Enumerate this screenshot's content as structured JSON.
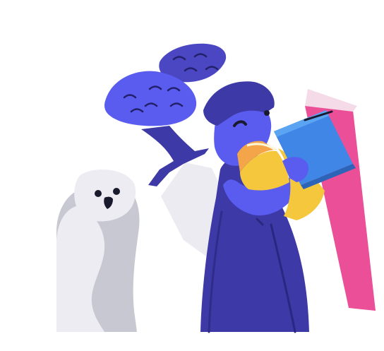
{
  "illustration": {
    "subjects": [
      "owl-icon",
      "wizard-figure-icon",
      "book-stack-icon",
      "tree-icon"
    ],
    "colors": {
      "indigo_dark": "#3d3aa7",
      "indigo": "#4b47c2",
      "periwinkle": "#5a5cf0",
      "blue_book": "#3f86e6",
      "blue_book_light": "#5aa4f2",
      "pink_book": "#ea4f97",
      "yellow_book": "#f5c73c",
      "orange_book": "#f4a54a",
      "owl_white": "#ececf2",
      "owl_grey": "#c7c8d2",
      "ink": "#1a1a2e",
      "shadow_grey": "#e6e6ee"
    }
  }
}
